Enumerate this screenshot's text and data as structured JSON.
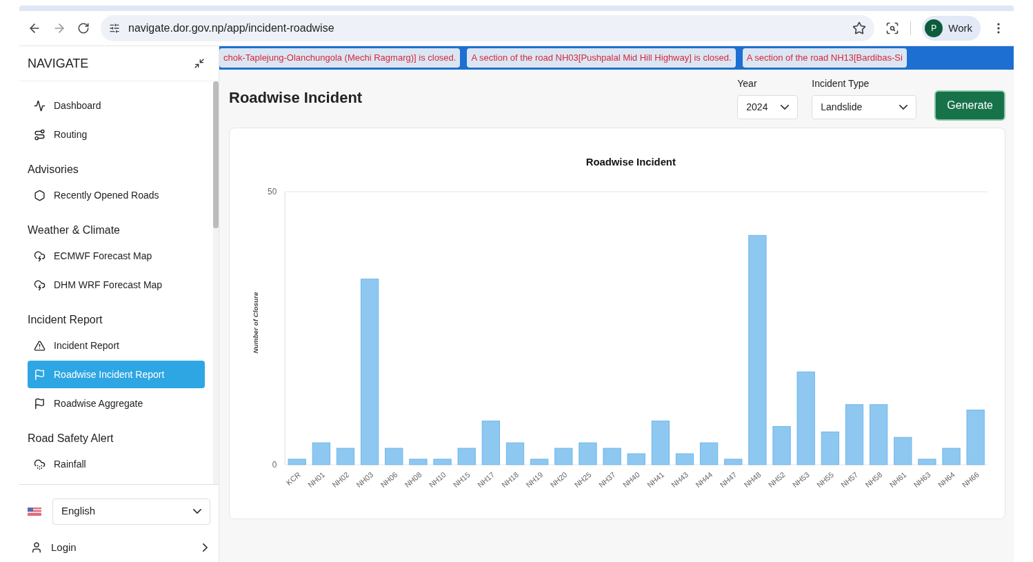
{
  "browser": {
    "url": "navigate.dor.gov.np/app/incident-roadwise",
    "profile": {
      "initial": "P",
      "label": "Work"
    }
  },
  "sidebar": {
    "title": "NAVIGATE",
    "sections": [
      {
        "items": [
          {
            "label": "Dashboard",
            "kind": "activity",
            "selected": false
          },
          {
            "label": "Routing",
            "kind": "route",
            "selected": false
          }
        ]
      },
      {
        "heading": "Advisories",
        "items": [
          {
            "label": "Recently Opened Roads",
            "kind": "hexagon",
            "selected": false
          }
        ]
      },
      {
        "heading": "Weather & Climate",
        "items": [
          {
            "label": "ECMWF Forecast Map",
            "kind": "storm",
            "selected": false
          },
          {
            "label": "DHM WRF Forecast Map",
            "kind": "storm",
            "selected": false
          }
        ]
      },
      {
        "heading": "Incident Report",
        "items": [
          {
            "label": "Incident Report",
            "kind": "alert",
            "selected": false
          },
          {
            "label": "Roadwise Incident Report",
            "kind": "flag",
            "selected": true
          },
          {
            "label": "Roadwise Aggregate",
            "kind": "flag",
            "selected": false
          }
        ]
      },
      {
        "heading": "Road Safety Alert",
        "items": [
          {
            "label": "Rainfall",
            "kind": "rain",
            "selected": false
          }
        ]
      }
    ],
    "language": "English",
    "login": "Login"
  },
  "ticker": [
    "chok-Taplejung-Olanchungola (Mechi Ragmarg)] is closed.",
    "A section of the road NH03[Pushpalal Mid Hill Highway] is closed.",
    "A section of the road NH13[Bardibas-Si"
  ],
  "main": {
    "title": "Roadwise Incident",
    "year": {
      "label": "Year",
      "value": "2024"
    },
    "incident_type": {
      "label": "Incident Type",
      "value": "Landslide"
    },
    "generate": "Generate",
    "chart_data": {
      "type": "bar",
      "title": "Roadwise Incident",
      "ylabel": "Number of Closure",
      "categories": [
        "KCR",
        "NH01",
        "NH02",
        "NH03",
        "NH06",
        "NH08",
        "NH10",
        "NH15",
        "NH17",
        "NH18",
        "NH19",
        "NH20",
        "NH25",
        "NH37",
        "NH40",
        "NH41",
        "NH43",
        "NH44",
        "NH47",
        "NH48",
        "NH52",
        "NH53",
        "NH55",
        "NH57",
        "NH58",
        "NH61",
        "NH63",
        "NH64",
        "NH66"
      ],
      "values": [
        1,
        4,
        3,
        34,
        3,
        1,
        1,
        3,
        8,
        4,
        1,
        3,
        4,
        3,
        2,
        8,
        2,
        4,
        1,
        42,
        7,
        17,
        6,
        11,
        11,
        5,
        1,
        3,
        10
      ],
      "ylim": [
        0,
        50
      ],
      "yticks": [
        0,
        50
      ]
    }
  }
}
